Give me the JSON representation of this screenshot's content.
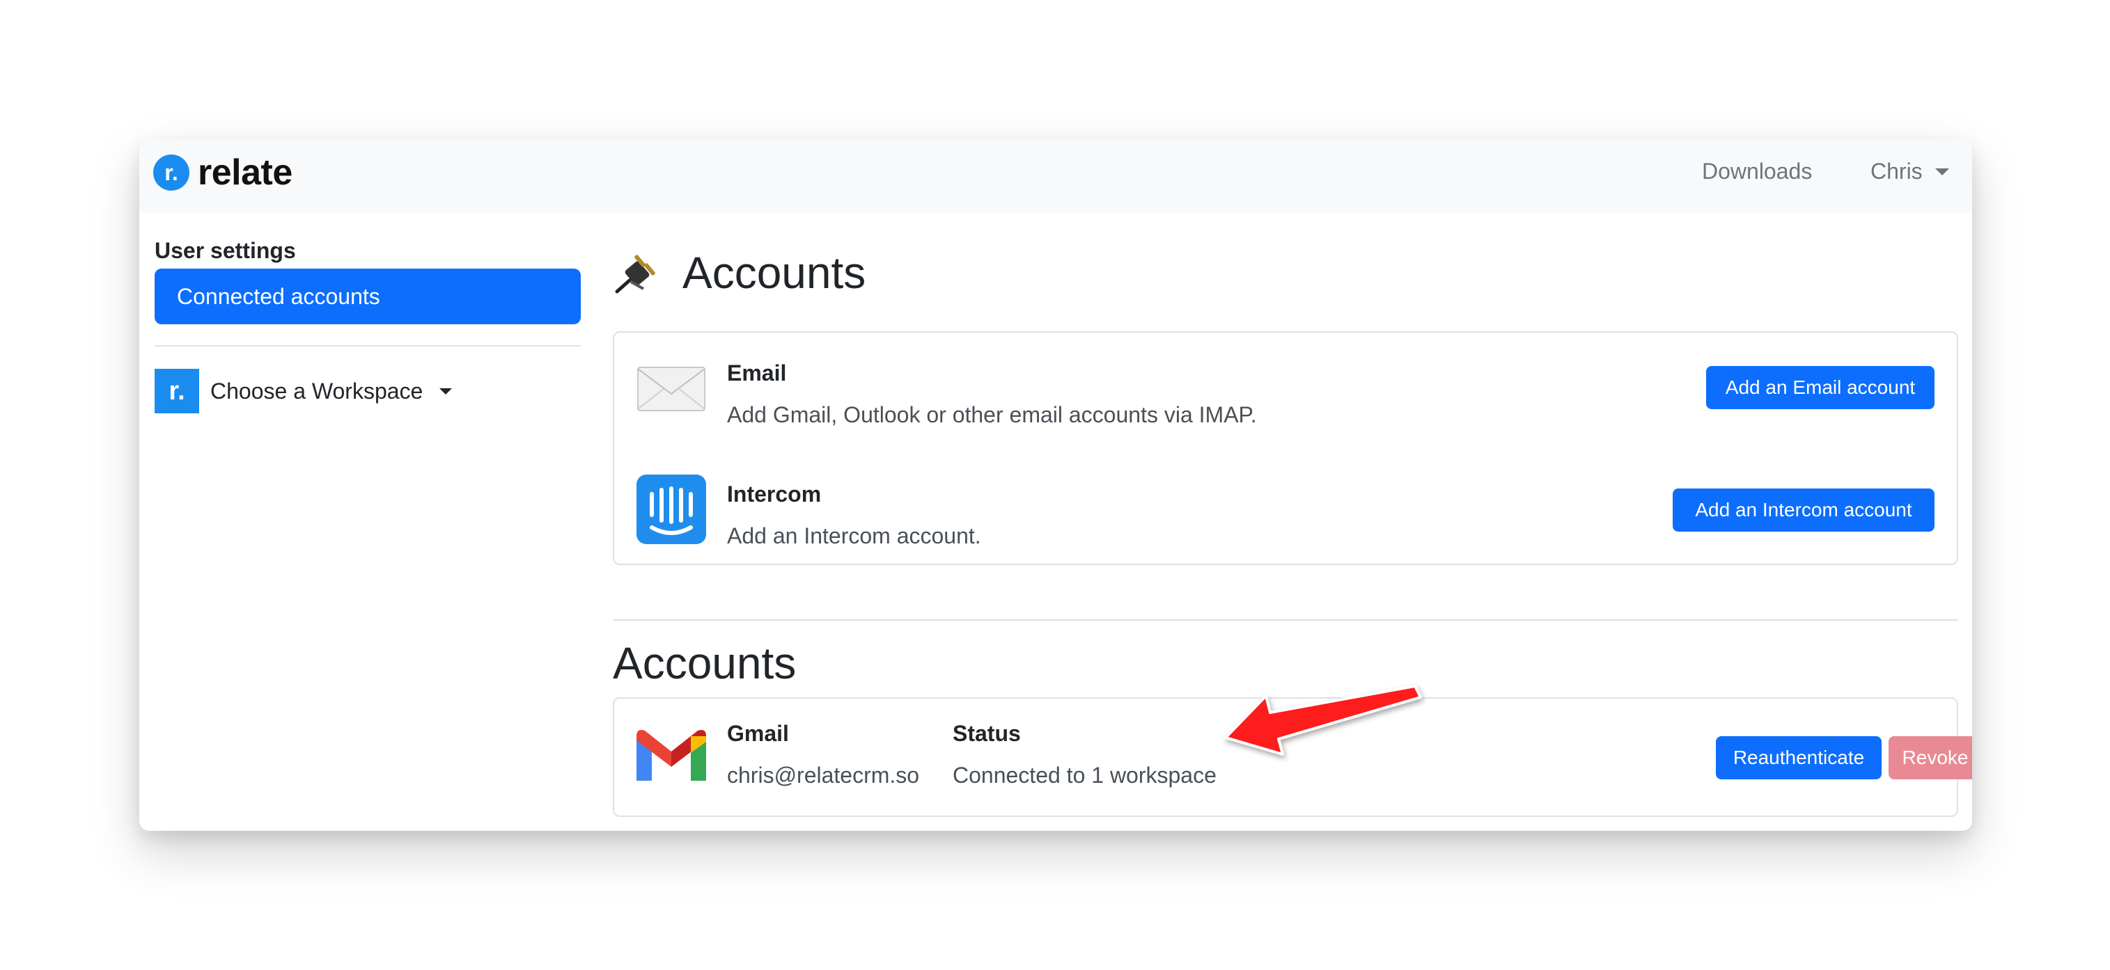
{
  "navbar": {
    "brand_logo_letter": "r.",
    "brand_name": "relate",
    "downloads_label": "Downloads",
    "user_label": "Chris"
  },
  "sidebar": {
    "heading": "User settings",
    "active_item": "Connected accounts",
    "workspace_logo_letter": "r.",
    "workspace_label": "Choose a Workspace"
  },
  "page": {
    "title": "Accounts",
    "title_icon": "plug-icon"
  },
  "providers": [
    {
      "icon": "envelope-icon",
      "title": "Email",
      "description": "Add Gmail, Outlook or other email accounts via IMAP.",
      "button_label": "Add an Email account"
    },
    {
      "icon": "intercom-icon",
      "title": "Intercom",
      "description": "Add an Intercom account.",
      "button_label": "Add an Intercom account"
    }
  ],
  "accounts_section": {
    "title": "Accounts",
    "items": [
      {
        "icon": "gmail-icon",
        "provider": "Gmail",
        "email": "chris@relatecrm.so",
        "status_label": "Status",
        "status": "Connected to 1 workspace",
        "reauth_label": "Reauthenticate",
        "revoke_label": "Revoke"
      }
    ]
  },
  "colors": {
    "primary": "#0d6efd",
    "brand": "#1a8cf0",
    "danger_disabled": "#e88a93",
    "annotation_arrow": "#ff1a1a"
  }
}
